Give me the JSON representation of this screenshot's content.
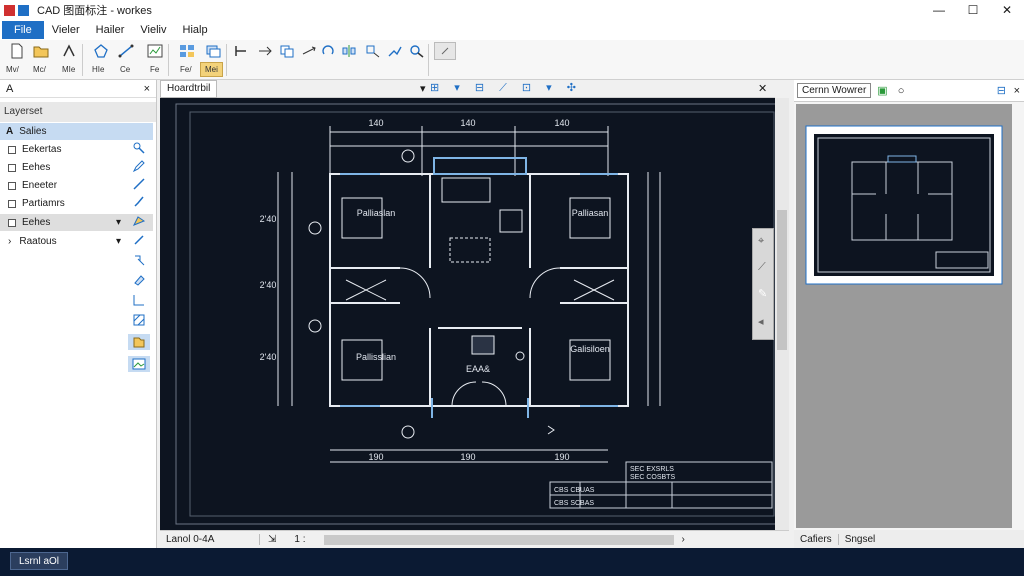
{
  "window": {
    "title": "CAD 图面标注 - workes",
    "controls": [
      "—",
      "☐",
      "✕"
    ]
  },
  "menu": {
    "items": [
      "File",
      "Vieler",
      "Hailer",
      "Vieliv",
      "Hialp"
    ]
  },
  "ribbon": {
    "labels": [
      "Mv/",
      "Mc/",
      "MIe",
      "HIe",
      "Ce",
      "Fe",
      "Fe/",
      "Mei"
    ]
  },
  "left_panel": {
    "header": "A",
    "header_actions": [
      "×",
      "×"
    ],
    "title": "Layerset",
    "layers": [
      {
        "label": "Salies",
        "selected": true
      },
      {
        "label": "Eekertas"
      },
      {
        "label": "Eehes"
      },
      {
        "label": "Eneeter"
      },
      {
        "label": "Partiamrs"
      },
      {
        "label": "Eehes",
        "hover": true
      },
      {
        "label": "Raatous"
      }
    ]
  },
  "canvas": {
    "tab": "Hoardtrbil",
    "rooms": [
      "Palliaslan",
      "Pallisslian",
      "Palliasan",
      "Galisiloen",
      "EAA&"
    ],
    "dims_top": [
      "140",
      "140",
      "140"
    ],
    "dims_bottom": [
      "190",
      "190",
      "190"
    ],
    "dims_side": [
      "2'40",
      "2'40",
      "2'40"
    ],
    "title_block": [
      "SEC EXSRLS",
      "SEC COSBTS",
      "CBS CBUAS",
      "CBS SCBAS"
    ]
  },
  "status": {
    "left": "Lanol 0-4A",
    "zoom": "1 :"
  },
  "right_panel": {
    "tab": "Cernn Wowrer",
    "footer_tabs": [
      "Cafiers",
      "Sngsel"
    ]
  },
  "taskbar": {
    "item": "Lsrnl aOl"
  },
  "colors": {
    "accent": "#1f6fc5",
    "canvas_bg": "#0d1420",
    "line": "#d8dde6",
    "highlight": "#7fb5e6"
  }
}
